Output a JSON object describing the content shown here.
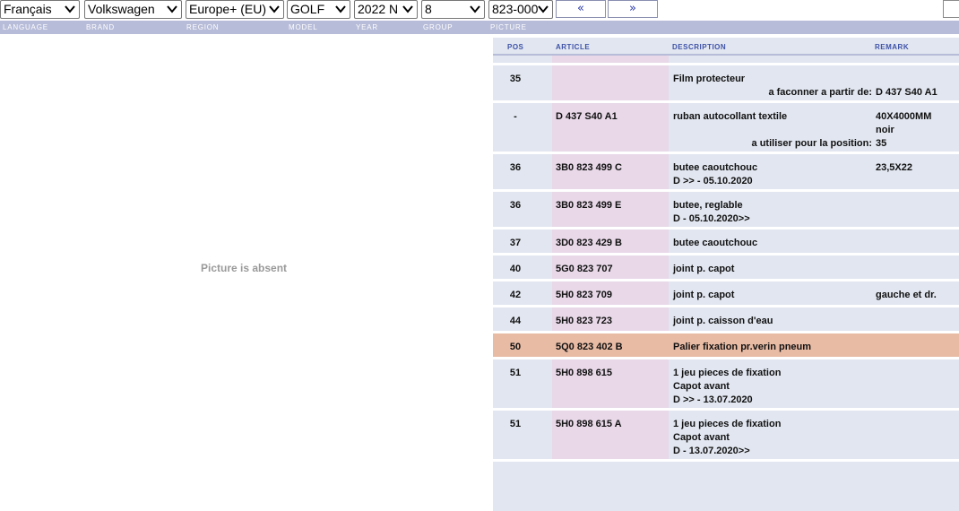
{
  "toolbar": {
    "language": "Français",
    "brand": "Volkswagen",
    "region": "Europe+ (EU)",
    "model": "GOLF",
    "year": "2022  N",
    "group": "8",
    "picture": "823-000",
    "prev_label": "«",
    "next_label": "»"
  },
  "labels": {
    "language": "LANGUAGE",
    "brand": "BRAND",
    "region": "REGION",
    "model": "MODEL",
    "year": "YEAR",
    "group": "GROUP",
    "picture": "PICTURE"
  },
  "picture_panel": {
    "message": "Picture is absent"
  },
  "table": {
    "headers": {
      "pos": "POS",
      "article": "ARTICLE",
      "description": "DESCRIPTION",
      "remark": "REMARK"
    },
    "rows": [
      {
        "pos": "35",
        "article": "",
        "desc": [
          "Film protecteur"
        ],
        "remark": [],
        "note_label": "a faconner a partir de:",
        "note_value": "D   437  S40 A1"
      },
      {
        "pos": "-",
        "article": "D   437  S40 A1",
        "desc": [
          "ruban autocollant textile"
        ],
        "remark": [
          "40X4000MM",
          "noir"
        ],
        "note_label": "a utiliser pour la position:",
        "note_value": "35"
      },
      {
        "pos": "36",
        "article": "3B0 823 499 C",
        "desc": [
          "butee caoutchouc",
          "D            >> - 05.10.2020"
        ],
        "remark": [
          "23,5X22"
        ]
      },
      {
        "pos": "36",
        "article": "3B0 823 499 E",
        "desc": [
          "butee, reglable",
          "D - 05.10.2020>>"
        ],
        "remark": []
      },
      {
        "pos": "37",
        "article": "3D0 823 429 B",
        "desc": [
          "butee caoutchouc"
        ],
        "remark": []
      },
      {
        "pos": "40",
        "article": "5G0 823 707",
        "desc": [
          "joint p. capot"
        ],
        "remark": []
      },
      {
        "pos": "42",
        "article": "5H0 823 709",
        "desc": [
          "joint p. capot"
        ],
        "remark": [
          "gauche et dr."
        ]
      },
      {
        "pos": "44",
        "article": "5H0 823 723",
        "desc": [
          "joint p. caisson d'eau"
        ],
        "remark": []
      },
      {
        "pos": "50",
        "article": "5Q0 823 402 B",
        "desc": [
          "Palier fixation pr.verin pneum"
        ],
        "remark": [],
        "highlight": true
      },
      {
        "pos": "51",
        "article": "5H0 898 615",
        "desc": [
          "1 jeu pieces de fixation",
          "Capot avant",
          "D            >> - 13.07.2020"
        ],
        "remark": []
      },
      {
        "pos": "51",
        "article": "5H0 898 615 A",
        "desc": [
          "1 jeu pieces de fixation",
          "Capot avant",
          "D - 13.07.2020>>"
        ],
        "remark": []
      }
    ]
  },
  "colors": {
    "label_bar": "#b7bcd8",
    "row_bg": "#e1e6f0",
    "article_bg": "#e8d8e8",
    "highlight": "#e8bba5",
    "header_text": "#3f52a8"
  }
}
